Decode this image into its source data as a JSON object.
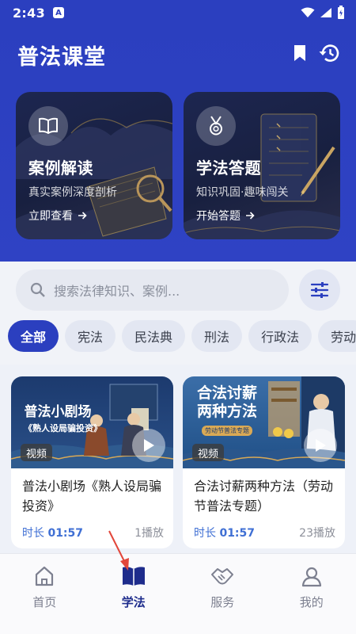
{
  "status_bar": {
    "time": "2:43",
    "notification_badge": "A",
    "icons": [
      "wifi-icon",
      "signal-icon",
      "battery-icon"
    ]
  },
  "header": {
    "title": "普法课堂",
    "icons": [
      "bookmark-icon",
      "history-icon"
    ]
  },
  "feature_cards": [
    {
      "title": "案例解读",
      "subtitle": "真实案例深度剖析",
      "action": "立即查看",
      "icon": "book-icon"
    },
    {
      "title": "学法答题",
      "subtitle": "知识巩固·趣味闯关",
      "action": "开始答题",
      "icon": "medal-icon"
    }
  ],
  "search": {
    "placeholder": "搜索法律知识、案例..."
  },
  "categories": [
    "全部",
    "宪法",
    "民法典",
    "刑法",
    "行政法",
    "劳动"
  ],
  "active_category": "全部",
  "videos": [
    {
      "thumb_line1": "普法小剧场",
      "thumb_line2": "《熟人设局骗投资》",
      "badge": "视频",
      "title": "普法小剧场《熟人设局骗投资》",
      "duration_label": "时长",
      "duration": "01:57",
      "plays": "1播放"
    },
    {
      "thumb_line1": "合法讨薪",
      "thumb_line2": "两种方法",
      "thumb_line3": "劳动节普法专题",
      "badge": "视频",
      "title": "合法讨薪两种方法（劳动节普法专题）",
      "duration_label": "时长",
      "duration": "01:57",
      "plays": "23播放"
    }
  ],
  "bottom_nav": [
    {
      "label": "首页",
      "icon": "home-icon"
    },
    {
      "label": "学法",
      "icon": "open-book-icon",
      "active": true
    },
    {
      "label": "服务",
      "icon": "handshake-icon"
    },
    {
      "label": "我的",
      "icon": "user-icon"
    }
  ],
  "colors": {
    "primary": "#2b3fbf",
    "accent_blue": "#3f6fd4",
    "nav_active": "#1e2c8c",
    "pointer": "#e2463a"
  }
}
